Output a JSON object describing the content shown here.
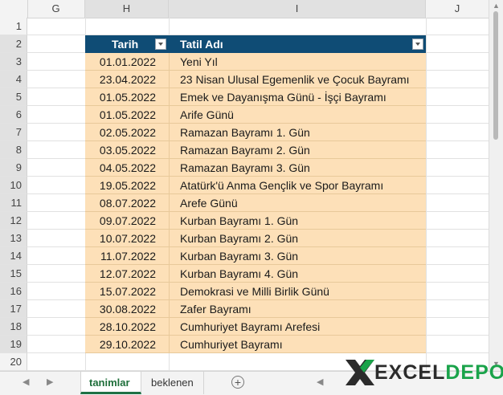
{
  "columns": [
    "G",
    "H",
    "I",
    "J"
  ],
  "rows": [
    "1",
    "2",
    "3",
    "4",
    "5",
    "6",
    "7",
    "8",
    "9",
    "10",
    "11",
    "12",
    "13",
    "14",
    "15",
    "16",
    "17",
    "18",
    "19",
    "20"
  ],
  "table": {
    "headers": {
      "date": "Tarih",
      "name": "Tatil Adı"
    },
    "rows": [
      {
        "date": "01.01.2022",
        "name": "Yeni Yıl"
      },
      {
        "date": "23.04.2022",
        "name": "23 Nisan Ulusal Egemenlik ve Çocuk Bayramı"
      },
      {
        "date": "01.05.2022",
        "name": "Emek ve Dayanışma Günü - İşçi Bayramı"
      },
      {
        "date": "01.05.2022",
        "name": "Arife Günü"
      },
      {
        "date": "02.05.2022",
        "name": "Ramazan Bayramı 1. Gün"
      },
      {
        "date": "03.05.2022",
        "name": "Ramazan Bayramı 2. Gün"
      },
      {
        "date": "04.05.2022",
        "name": "Ramazan Bayramı 3. Gün"
      },
      {
        "date": "19.05.2022",
        "name": "Atatürk'ü Anma Gençlik ve Spor Bayramı"
      },
      {
        "date": "08.07.2022",
        "name": "Arefe Günü"
      },
      {
        "date": "09.07.2022",
        "name": "Kurban Bayramı 1. Gün"
      },
      {
        "date": "10.07.2022",
        "name": "Kurban Bayramı 2. Gün"
      },
      {
        "date": "11.07.2022",
        "name": "Kurban Bayramı 3. Gün"
      },
      {
        "date": "12.07.2022",
        "name": "Kurban Bayramı 4. Gün"
      },
      {
        "date": "15.07.2022",
        "name": "Demokrasi ve Milli Birlik Günü"
      },
      {
        "date": "30.08.2022",
        "name": "Zafer Bayramı"
      },
      {
        "date": "28.10.2022",
        "name": "Cumhuriyet Bayramı Arefesi"
      },
      {
        "date": "29.10.2022",
        "name": "Cumhuriyet Bayramı"
      }
    ]
  },
  "sheets": {
    "active": "tanimlar",
    "other": "beklenen",
    "add_icon": "plus-icon"
  },
  "logo": {
    "part1": "EXCEL",
    "part2": "DEPO"
  },
  "colors": {
    "header_bg": "#0f4c75",
    "row_bg": "#fde0b8",
    "active_tab": "#1e7145",
    "logo_green": "#1aa34a"
  }
}
